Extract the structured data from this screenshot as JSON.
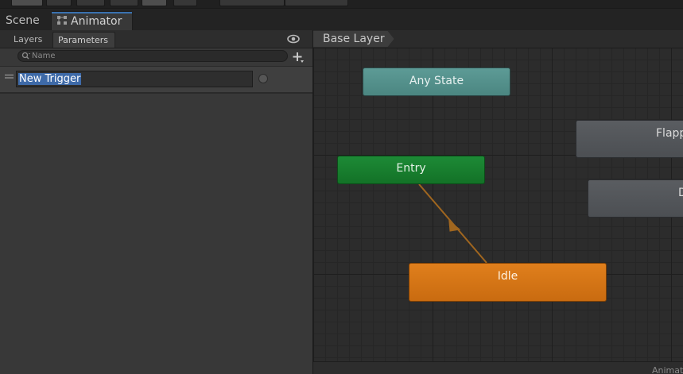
{
  "tabs": {
    "scene_label": "Scene",
    "animator_label": "Animator"
  },
  "left_panel": {
    "tabs": [
      "Layers",
      "Parameters"
    ],
    "active_tab": "Parameters",
    "search": {
      "placeholder": "Name",
      "value": ""
    },
    "parameters": [
      {
        "name": "New Trigger",
        "type": "trigger",
        "selected_text": true
      }
    ]
  },
  "graph": {
    "breadcrumb": "Base Layer",
    "states": {
      "any_state": "Any State",
      "entry": "Entry",
      "idle": "Idle",
      "flap": "Flapp",
      "d": "D"
    },
    "bottom_label": "Animat"
  },
  "colors": {
    "any_state": "#5d9b96",
    "entry": "#1d8a36",
    "default_state": "#e07f1c",
    "transition": "#a0661f",
    "selection": "#3e6aa8"
  }
}
